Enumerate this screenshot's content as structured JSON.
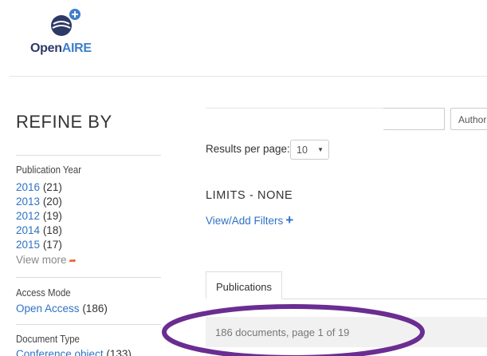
{
  "brand": {
    "logo_part1": "Open",
    "logo_part2": "AIRE",
    "colors": {
      "dark": "#2d3a66",
      "blue": "#3d7fcc"
    }
  },
  "sidebar": {
    "title": "REFINE BY",
    "publication_year": {
      "title": "Publication Year",
      "items": [
        {
          "value": "2016",
          "count": "(21)"
        },
        {
          "value": "2013",
          "count": "(20)"
        },
        {
          "value": "2012",
          "count": "(19)"
        },
        {
          "value": "2014",
          "count": "(18)"
        },
        {
          "value": "2015",
          "count": "(17)"
        }
      ],
      "view_more": "View more"
    },
    "access_mode": {
      "title": "Access Mode",
      "items": [
        {
          "value": "Open Access",
          "count": "(186)"
        }
      ]
    },
    "document_type": {
      "title": "Document Type",
      "items": [
        {
          "value": "Conference object",
          "count": "(133)"
        }
      ]
    }
  },
  "search": {
    "field_select": "Author"
  },
  "results_per_page": {
    "label": "Results per page:",
    "value": "10"
  },
  "limits": {
    "text": "LIMITS  - NONE",
    "filters_link": "View/Add Filters"
  },
  "tabs": [
    {
      "label": "Publications"
    }
  ],
  "results": {
    "summary": "186 documents, page 1 of 19"
  },
  "colors": {
    "link": "#2f72c4",
    "highlight_ellipse": "#6a2d91",
    "view_more_icon": "#e8613b"
  }
}
